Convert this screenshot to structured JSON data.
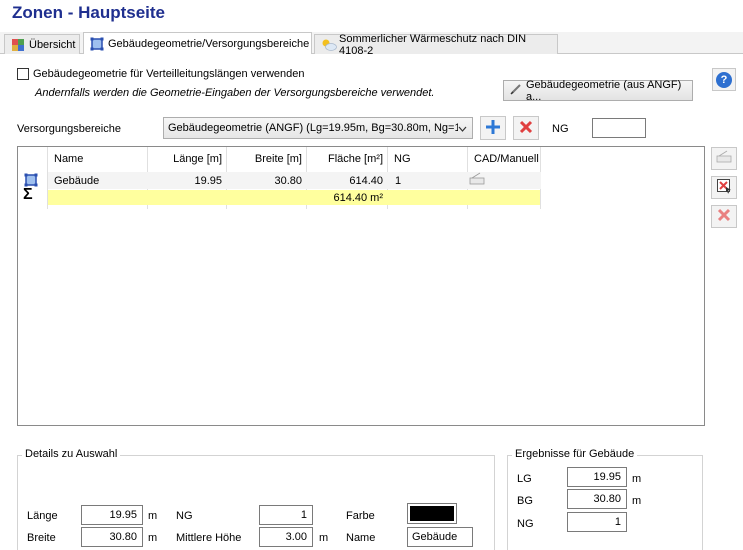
{
  "title": "Zonen - Hauptseite",
  "tabs": [
    {
      "label": "Übersicht"
    },
    {
      "label": "Gebäudegeometrie/Versorgungsbereiche"
    },
    {
      "label": "Sommerlicher Wärmeschutz nach DIN 4108-2"
    }
  ],
  "geometry_option": {
    "checkbox_label": "Gebäudegeometrie für Verteilleitungslängen verwenden",
    "hint": "Andernfalls werden die Geometrie-Eingaben der Versorgungsbereiche verwendet.",
    "import_button": "Gebäudegeometrie (aus ANGF) a..."
  },
  "versorgung": {
    "label": "Versorgungsbereiche",
    "selected": "Gebäudegeometrie (ANGF) (Lg=19.95m, Bg=30.80m, Ng=1)",
    "ng_label": "NG",
    "ng_value": ""
  },
  "table": {
    "headers": [
      "Name",
      "Länge [m]",
      "Breite [m]",
      "Fläche [m²]",
      "NG",
      "CAD/Manuell"
    ],
    "row": {
      "name": "Gebäude",
      "laenge": "19.95",
      "breite": "30.80",
      "flaeche": "614.40",
      "ng": "1"
    },
    "sum": {
      "symbol": "Σ",
      "flaeche": "614.40 m²"
    }
  },
  "details": {
    "title": "Details zu Auswahl",
    "laenge_label": "Länge",
    "laenge_value": "19.95",
    "laenge_unit": "m",
    "breite_label": "Breite",
    "breite_value": "30.80",
    "breite_unit": "m",
    "ng_label": "NG",
    "ng_value": "1",
    "hoehe_label": "Mittlere Höhe",
    "hoehe_value": "3.00",
    "hoehe_unit": "m",
    "farbe_label": "Farbe",
    "farbe_value": "#000000",
    "name_label": "Name",
    "name_value": "Gebäude"
  },
  "ergebnisse": {
    "title": "Ergebnisse für Gebäude",
    "lg_label": "LG",
    "lg_value": "19.95",
    "lg_unit": "m",
    "bg_label": "BG",
    "bg_value": "30.80",
    "bg_unit": "m",
    "ng_label": "NG",
    "ng_value": "1"
  },
  "help_symbol": "?",
  "colors": {
    "title": "#1f2f8f",
    "sum_row": "#ffff9e",
    "delete": "#e04040",
    "add": "#2d78d6",
    "help": "#2d6fd0"
  }
}
